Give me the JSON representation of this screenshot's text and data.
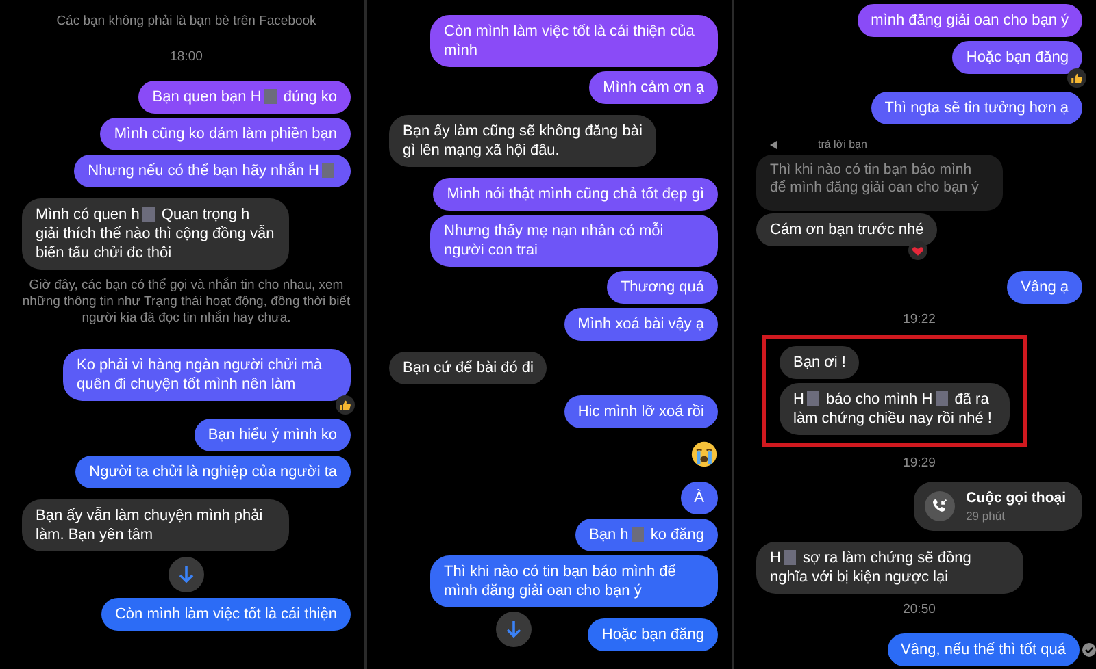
{
  "panels": [
    {
      "items": [
        {
          "kind": "notice",
          "text": "Các bạn không phải là bạn bè trên Facebook"
        },
        {
          "kind": "time",
          "text": "18:00"
        },
        {
          "kind": "sent",
          "segments": [
            "Bạn quen bạn H",
            "đúng ko"
          ]
        },
        {
          "kind": "sent",
          "segments": [
            "Mình cũng ko dám làm phiền bạn"
          ]
        },
        {
          "kind": "sent",
          "segments": [
            "Nhưng nếu có thể bạn hãy nhắn H"
          ],
          "trailing_blur": true
        },
        {
          "kind": "received",
          "segments": [
            "Mình có quen h",
            "Quan trọng h giải thích thế nào thì cộng đồng vẫn biến tấu chửi đc thôi"
          ]
        },
        {
          "kind": "notice",
          "text": "Giờ đây, các bạn có thể gọi và nhắn tin cho nhau, xem những thông tin như Trạng thái hoạt động, đồng thời biết người kia đã đọc tin nhắn hay chưa."
        },
        {
          "kind": "sent",
          "segments": [
            "Ko phải vì hàng ngàn người chửi mà quên đi chuyện tốt mình nên làm"
          ],
          "thumbs_up": true
        },
        {
          "kind": "sent",
          "segments": [
            "Bạn hiểu ý mình ko"
          ]
        },
        {
          "kind": "sent",
          "segments": [
            "Người ta chửi là nghiệp của người ta"
          ]
        },
        {
          "kind": "received",
          "segments": [
            "Bạn ấy vẫn làm chuyện mình phải làm. Bạn yên tâm"
          ]
        },
        {
          "kind": "scroll"
        },
        {
          "kind": "sent",
          "segments": [
            "Còn mình làm việc tốt là cái thiện"
          ]
        }
      ]
    },
    {
      "items": [
        {
          "kind": "sent",
          "segments": [
            "Còn mình làm việc tốt là cái thiện của mình"
          ]
        },
        {
          "kind": "sent",
          "segments": [
            "Mình cảm ơn ạ"
          ]
        },
        {
          "kind": "received",
          "segments": [
            "Bạn ấy làm cũng sẽ không đăng bài gì lên mạng xã hội đâu."
          ]
        },
        {
          "kind": "sent",
          "segments": [
            "Mình nói thật mình cũng chả tốt đẹp gì"
          ]
        },
        {
          "kind": "sent",
          "segments": [
            "Nhưng thấy mẹ nạn nhân có mỗi người con trai"
          ]
        },
        {
          "kind": "sent",
          "segments": [
            "Thương quá"
          ]
        },
        {
          "kind": "sent",
          "segments": [
            "Mình xoá bài vậy ạ"
          ]
        },
        {
          "kind": "received",
          "segments": [
            "Bạn cứ để bài đó đi"
          ]
        },
        {
          "kind": "sent",
          "segments": [
            "Hic mình lỡ xoá rồi"
          ]
        },
        {
          "kind": "emoji"
        },
        {
          "kind": "sent",
          "segments": [
            "À"
          ]
        },
        {
          "kind": "sent",
          "segments": [
            "Bạn h",
            "ko đăng"
          ]
        },
        {
          "kind": "sent",
          "segments": [
            "Thì khi nào có tin bạn báo mình để mình đăng giải oan cho bạn ý"
          ]
        },
        {
          "kind": "scroll"
        },
        {
          "kind": "sent",
          "segments": [
            "Hoặc bạn đăng"
          ]
        }
      ]
    },
    {
      "items": [
        {
          "kind": "sent",
          "segments": [
            "mình đăng giải oan cho bạn ý"
          ]
        },
        {
          "kind": "sent",
          "segments": [
            "Hoặc bạn đăng"
          ],
          "thumbs_up": true
        },
        {
          "kind": "sent",
          "segments": [
            "Thì ngta sẽ tin tưởng hơn ạ"
          ]
        },
        {
          "kind": "quote",
          "label": "trả lời bạn",
          "text": "Thì khi nào có tin bạn báo mình để mình đăng giải oan cho bạn ý"
        },
        {
          "kind": "received",
          "segments": [
            "Cám ơn bạn trước nhé"
          ],
          "heart": true
        },
        {
          "kind": "sent",
          "segments": [
            "Vâng ạ"
          ]
        },
        {
          "kind": "time",
          "text": "19:22"
        },
        {
          "kind": "highlight",
          "items": [
            {
              "kind": "received",
              "segments": [
                "Bạn ơi !"
              ]
            },
            {
              "kind": "received",
              "segments": [
                "H",
                "báo cho mình H",
                "đã ra làm chứng chiều nay rồi nhé !"
              ]
            }
          ]
        },
        {
          "kind": "time",
          "text": "19:29"
        },
        {
          "kind": "call",
          "title": "Cuộc gọi thoại",
          "duration": "29 phút"
        },
        {
          "kind": "received",
          "segments": [
            "H",
            "sợ ra làm chứng sẽ đồng nghĩa với bị kiện ngược lại"
          ]
        },
        {
          "kind": "time",
          "text": "20:50"
        },
        {
          "kind": "sent",
          "segments": [
            "Vâng, nếu thế thì tốt quá"
          ],
          "seen": true
        }
      ]
    }
  ]
}
